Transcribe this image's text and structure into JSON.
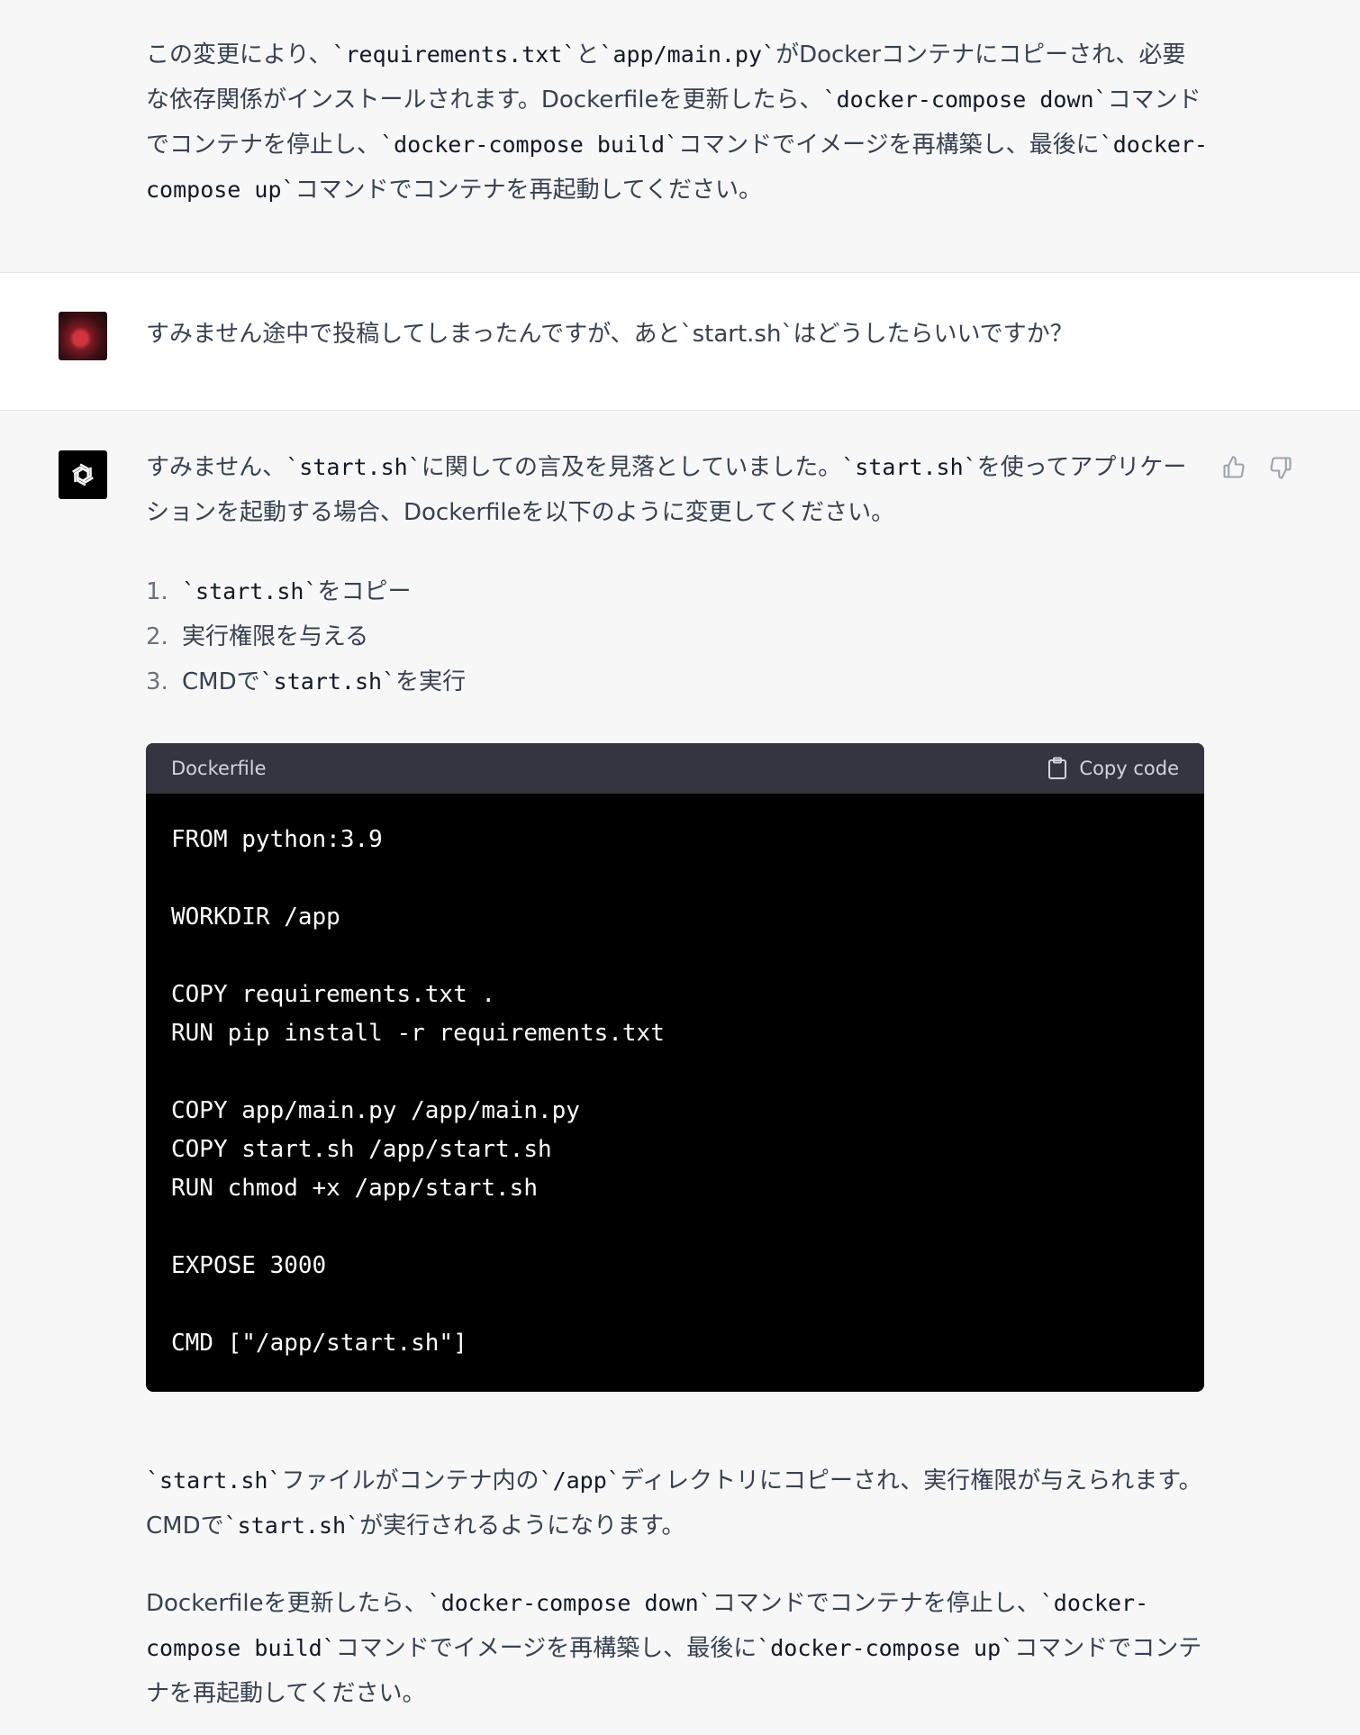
{
  "message_prev": {
    "p": [
      {
        "t": "この変更により、"
      },
      {
        "c": "`requirements.txt`"
      },
      {
        "t": "と"
      },
      {
        "c": "`app/main.py`"
      },
      {
        "t": "がDockerコンテナにコピーされ、必要な依存関係がインストールされます。Dockerfileを更新したら、"
      },
      {
        "c": "`docker-compose down`"
      },
      {
        "t": "コマンドでコンテナを停止し、"
      },
      {
        "c": "`docker-compose build`"
      },
      {
        "t": "コマンドでイメージを再構築し、最後に"
      },
      {
        "c": "`docker-compose up`"
      },
      {
        "t": "コマンドでコンテナを再起動してください。"
      }
    ]
  },
  "user_message": {
    "avatar_icon": "user-photo-avatar",
    "p": [
      {
        "t": "すみません途中で投稿してしまったんですが、あと"
      },
      {
        "t": "`start.sh`"
      },
      {
        "t": "はどうしたらいいですか？"
      }
    ]
  },
  "assistant_message": {
    "avatar_icon": "openai-logo-icon",
    "intro": [
      {
        "t": "すみません、"
      },
      {
        "c": "`start.sh`"
      },
      {
        "t": "に関しての言及を見落としていました。"
      },
      {
        "c": "`start.sh`"
      },
      {
        "t": "を使ってアプリケーションを起動する場合、Dockerfileを以下のように変更してください。"
      }
    ],
    "steps": [
      {
        "num": "1.",
        "parts": [
          {
            "c": "`start.sh`"
          },
          {
            "t": "をコピー"
          }
        ]
      },
      {
        "num": "2.",
        "parts": [
          {
            "t": "実行権限を与える"
          }
        ]
      },
      {
        "num": "3.",
        "parts": [
          {
            "t": "CMDで"
          },
          {
            "c": "`start.sh`"
          },
          {
            "t": "を実行"
          }
        ]
      }
    ],
    "code": {
      "language": "Dockerfile",
      "copy_label": "Copy code",
      "copy_icon": "clipboard-icon",
      "lines": "FROM python:3.9\n\nWORKDIR /app\n\nCOPY requirements.txt .\nRUN pip install -r requirements.txt\n\nCOPY app/main.py /app/main.py\nCOPY start.sh /app/start.sh\nRUN chmod +x /app/start.sh\n\nEXPOSE 3000\n\nCMD [\"/app/start.sh\"]"
    },
    "after1": [
      {
        "c": "`start.sh`"
      },
      {
        "t": "ファイルがコンテナ内の"
      },
      {
        "c": "`/app`"
      },
      {
        "t": "ディレクトリにコピーされ、実行権限が与えられます。CMDで"
      },
      {
        "c": "`start.sh`"
      },
      {
        "t": "が実行されるようになります。"
      }
    ],
    "after2": [
      {
        "t": "Dockerfileを更新したら、"
      },
      {
        "c": "`docker-compose down`"
      },
      {
        "t": "コマンドでコンテナを停止し、"
      },
      {
        "c": "`docker-compose build`"
      },
      {
        "t": "コマンドでイメージを再構築し、最後に"
      },
      {
        "c": "`docker-compose up`"
      },
      {
        "t": "コマンドでコンテナを再起動してください。"
      }
    ],
    "feedback": {
      "up_icon": "thumbs-up-icon",
      "down_icon": "thumbs-down-icon"
    }
  }
}
